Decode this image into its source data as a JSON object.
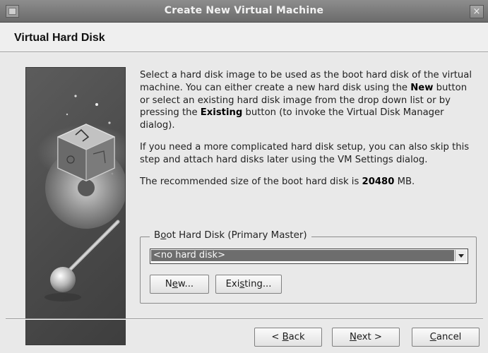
{
  "window": {
    "title": "Create New Virtual Machine",
    "close_glyph": "×"
  },
  "header": {
    "title": "Virtual Hard Disk"
  },
  "description": {
    "p1": {
      "part1": "Select a hard disk image to be used as the boot hard disk of the virtual machine. You can either create a new hard disk using the ",
      "bold1": "New",
      "part2": " button or select an existing hard disk image from the drop down list or by pressing the ",
      "bold2": "Existing",
      "part3": " button (to invoke the Virtual Disk Manager dialog)."
    },
    "p2": "If you need a more complicated hard disk setup, you can also skip this step and attach hard disks later using the VM Settings dialog.",
    "p3": {
      "part1": "The recommended size of the boot hard disk is ",
      "size": "20480",
      "part2": " MB."
    }
  },
  "boot_disk": {
    "group_label": {
      "pre": "B",
      "mnemonic": "o",
      "post": "ot Hard Disk (Primary Master)"
    },
    "selected": "<no hard disk>",
    "new_button": {
      "pre": "N",
      "mnemonic": "e",
      "post": "w..."
    },
    "existing_button": {
      "pre": "Exi",
      "mnemonic": "s",
      "post": "ting..."
    }
  },
  "footer": {
    "back": {
      "pre": "< ",
      "mnemonic": "B",
      "post": "ack"
    },
    "next": {
      "pre": "",
      "mnemonic": "N",
      "post": "ext >"
    },
    "cancel": {
      "pre": "",
      "mnemonic": "C",
      "post": "ancel"
    }
  },
  "icons": {
    "system_menu": "window-menu-icon",
    "close": "close-icon",
    "banner": "virtualbox-logo-graphic"
  }
}
